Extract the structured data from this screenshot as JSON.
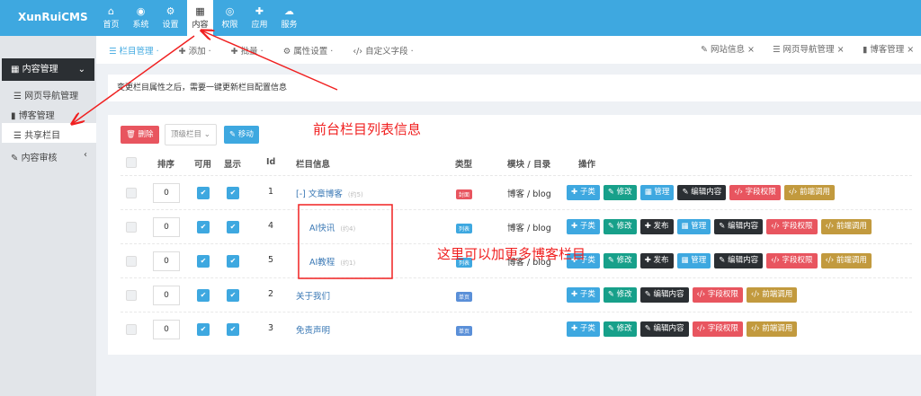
{
  "logo": "XunRuiCMS",
  "nav": [
    {
      "label": "首页",
      "icon": "home-icon",
      "glyph": "⌂"
    },
    {
      "label": "系统",
      "icon": "globe-icon",
      "glyph": "◉"
    },
    {
      "label": "设置",
      "icon": "gears-icon",
      "glyph": "⚙"
    },
    {
      "label": "内容",
      "icon": "grid-icon",
      "glyph": "▦",
      "active": true
    },
    {
      "label": "权限",
      "icon": "user-icon",
      "glyph": "◎"
    },
    {
      "label": "应用",
      "icon": "puzzle-icon",
      "glyph": "✚"
    },
    {
      "label": "服务",
      "icon": "cloud-icon",
      "glyph": "☁"
    }
  ],
  "sidebar": {
    "group": "内容管理",
    "items": [
      "网页导航管理",
      "博客管理",
      "共享栏目",
      "内容审核"
    ]
  },
  "toolbar": {
    "tabs": [
      "栏目管理",
      "添加",
      "批量",
      "属性设置",
      "自定义字段"
    ],
    "right": [
      "网站信息",
      "网页导航管理",
      "博客管理"
    ]
  },
  "notice": "变更栏目属性之后，需要一键更新栏目配置信息",
  "actions": {
    "delete": "删除",
    "select": "顶级栏目",
    "move": "移动"
  },
  "headers": [
    "排序",
    "可用",
    "显示",
    "Id",
    "栏目信息",
    "类型",
    "模块 / 目录",
    "操作"
  ],
  "rows": [
    {
      "sort": "0",
      "id": "1",
      "name": "[-] 文章博客",
      "count": "(约5)",
      "type": "封面",
      "type_color": "#e8555f",
      "module": "博客 / blog",
      "ops": [
        "子类",
        "修改",
        "管理",
        "编辑内容",
        "字段权限",
        "前端调用"
      ]
    },
    {
      "sort": "0",
      "id": "4",
      "name": "AI快讯",
      "count": "(约4)",
      "type": "列表",
      "type_color": "#3ea8e0",
      "module": "博客 / blog",
      "ops": [
        "子类",
        "修改",
        "发布",
        "管理",
        "编辑内容",
        "字段权限",
        "前端调用"
      ]
    },
    {
      "sort": "0",
      "id": "5",
      "name": "AI教程",
      "count": "(约1)",
      "type": "列表",
      "type_color": "#3ea8e0",
      "module": "博客 / blog",
      "ops": [
        "子类",
        "修改",
        "发布",
        "管理",
        "编辑内容",
        "字段权限",
        "前端调用"
      ]
    },
    {
      "sort": "0",
      "id": "2",
      "name": "关于我们",
      "count": "",
      "type": "单页",
      "type_color": "#5a8fd8",
      "module": "",
      "ops": [
        "子类",
        "修改",
        "编辑内容",
        "字段权限",
        "前端调用"
      ]
    },
    {
      "sort": "0",
      "id": "3",
      "name": "免责声明",
      "count": "",
      "type": "单页",
      "type_color": "#5a8fd8",
      "module": "",
      "ops": [
        "子类",
        "修改",
        "编辑内容",
        "字段权限",
        "前端调用"
      ]
    }
  ],
  "op_colors": {
    "子类": "#3ea8e0",
    "修改": "#17a08a",
    "管理": "#3ea8e0",
    "发布": "#2b2f33",
    "编辑内容": "#2b2f33",
    "字段权限": "#e8555f",
    "前端调用": "#c29a3e"
  },
  "annotations": [
    "前台栏目列表信息",
    "这里可以加更多博客栏目"
  ]
}
